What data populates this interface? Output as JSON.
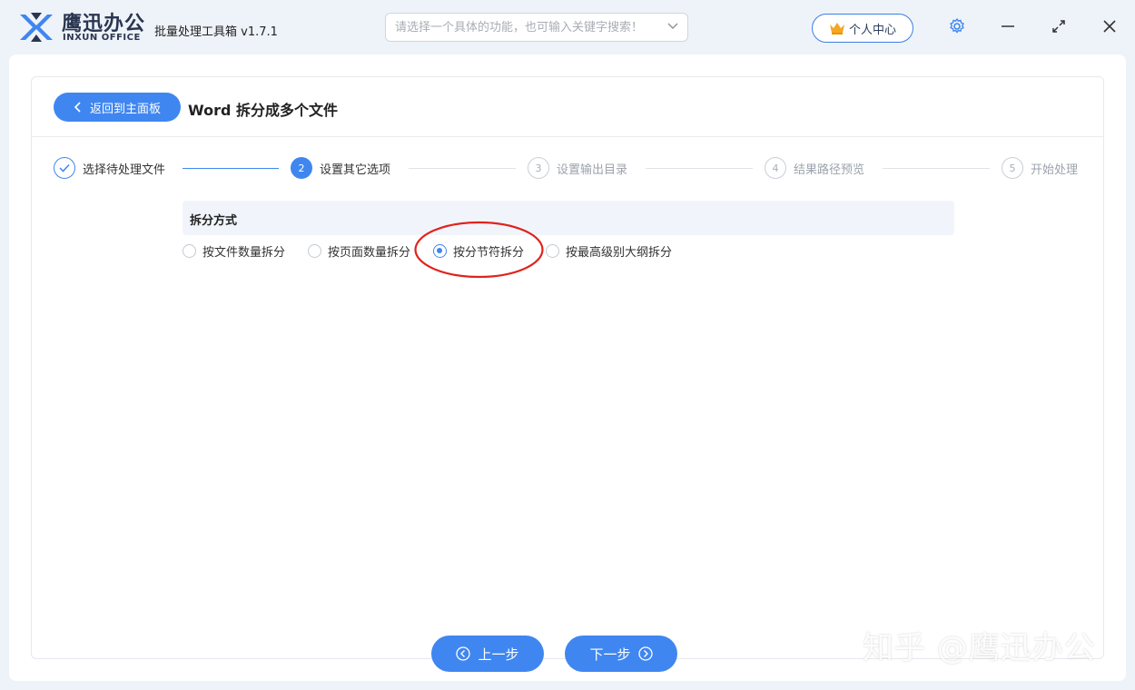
{
  "window": {
    "brand_cn": "鹰迅办公",
    "brand_en": "INXUN OFFICE",
    "app_name": "批量处理工具箱 v1.7.1",
    "search_placeholder": "请选择一个具体的功能，也可输入关键字搜索！",
    "user_center_label": "个人中心"
  },
  "header": {
    "back_label": "返回到主面板",
    "title": "Word 拆分成多个文件"
  },
  "steps": [
    {
      "num": "",
      "label": "选择待处理文件",
      "state": "done"
    },
    {
      "num": "2",
      "label": "设置其它选项",
      "state": "active"
    },
    {
      "num": "3",
      "label": "设置输出目录",
      "state": "todo"
    },
    {
      "num": "4",
      "label": "结果路径预览",
      "state": "todo"
    },
    {
      "num": "5",
      "label": "开始处理",
      "state": "todo"
    }
  ],
  "split_options": {
    "section_title": "拆分方式",
    "options": [
      {
        "label": "按文件数量拆分",
        "checked": false
      },
      {
        "label": "按页面数量拆分",
        "checked": false
      },
      {
        "label": "按分节符拆分",
        "checked": true
      },
      {
        "label": "按最高级别大纲拆分",
        "checked": false
      }
    ]
  },
  "footer": {
    "prev_label": "上一步",
    "next_label": "下一步"
  },
  "watermark": "知乎 @鹰迅办公",
  "colors": {
    "accent": "#3f86f0",
    "annotation": "#e0231c",
    "background": "#eef3f9"
  },
  "icons": [
    "logo-x-icon",
    "chevron-down-icon",
    "crown-icon",
    "gear-icon",
    "minimize-icon",
    "maximize-icon",
    "close-icon",
    "chevron-left-icon",
    "check-icon",
    "prev-circle-icon",
    "next-circle-icon"
  ]
}
